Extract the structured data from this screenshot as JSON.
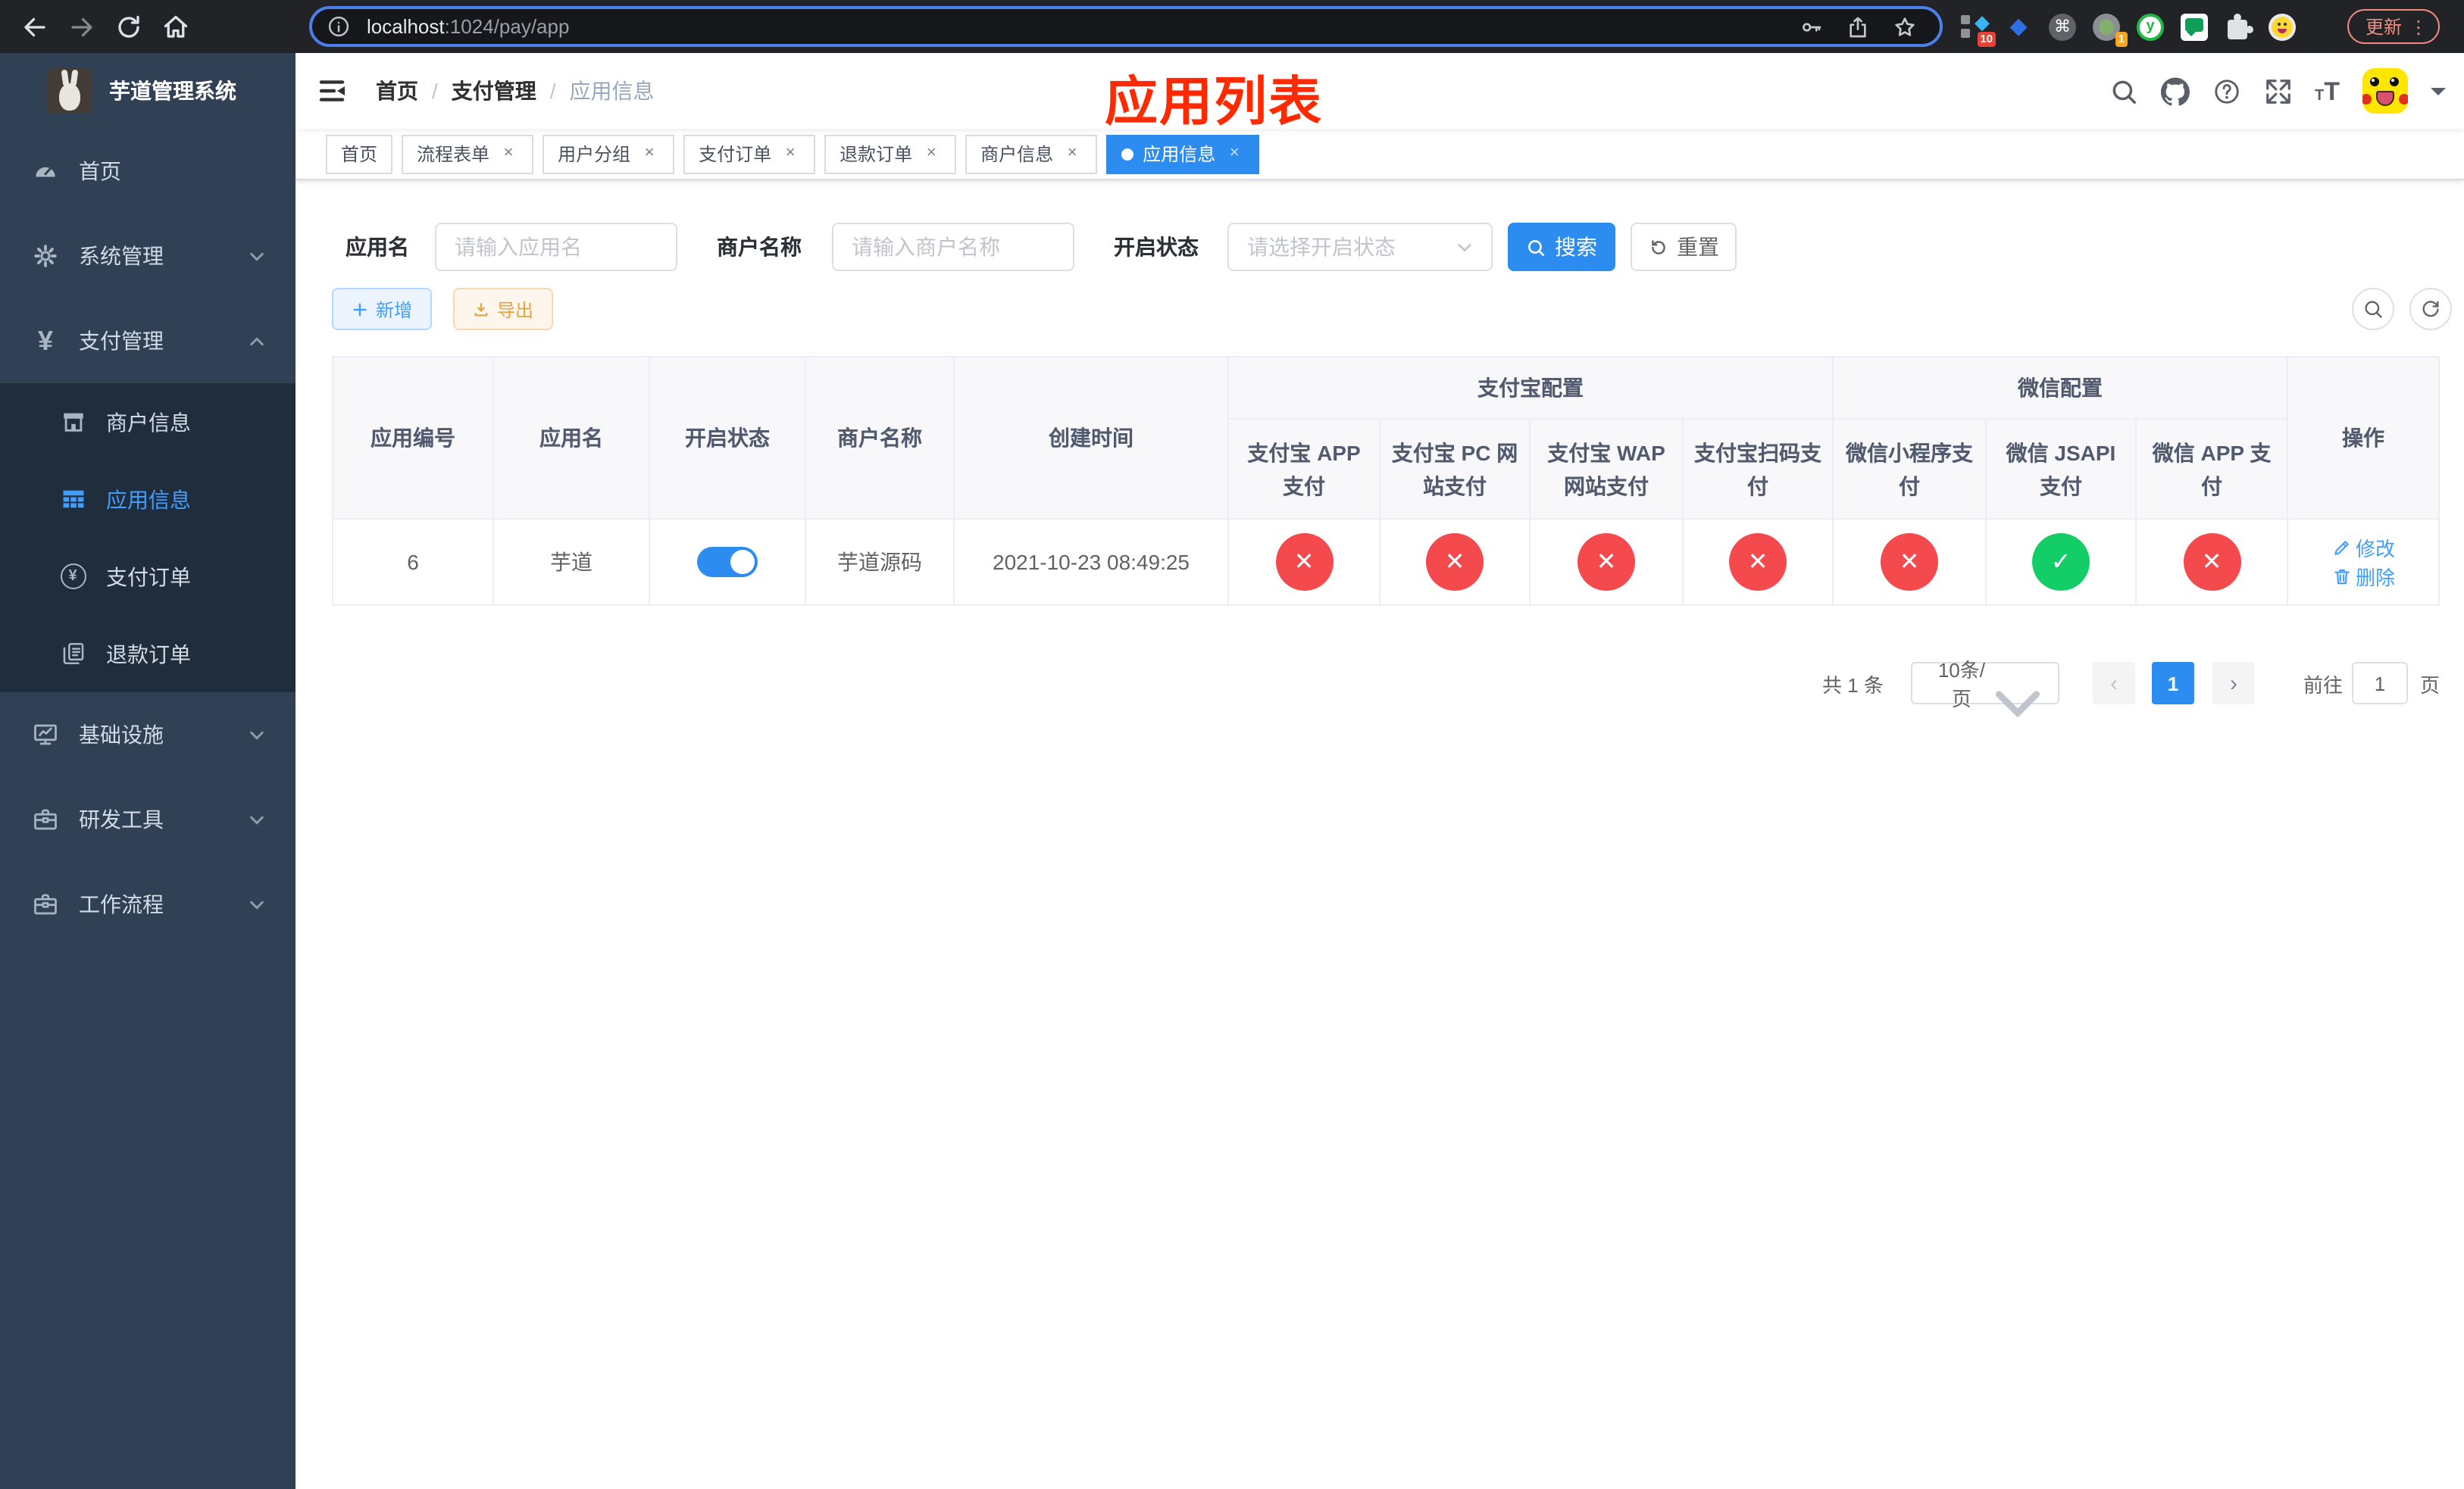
{
  "colors": {
    "accent_blue": "#409eff",
    "active_blue": "#2d8cf0",
    "danger_red": "#f4494d",
    "success_green": "#13ce66",
    "warning_orange": "#e6a23c",
    "overlay_title_red": "#ff2a00",
    "sidebar_bg": "#304156",
    "sidebar_submenu_bg": "#1f2d3d"
  },
  "icons": {
    "cmd_glyph": "⌘",
    "diamond_glyph": "◆",
    "kite_glyph": "◆",
    "dots_menu_glyph": "⋮",
    "prev_glyph": "‹",
    "next_glyph": "›",
    "check_glyph": "✓",
    "cross_glyph": "✕",
    "yen_glyph": "¥",
    "separator": "/",
    "y_letter": "y"
  },
  "browser": {
    "url_host": "localhost",
    "url_rest": ":1024/pay/app",
    "update_label": "更新",
    "ext_badge_vue": "10",
    "ext_badge_recorder": "1"
  },
  "sidebar": {
    "title": "芋道管理系统",
    "menu": [
      {
        "label": "首页"
      },
      {
        "label": "系统管理",
        "expanded": false
      },
      {
        "label": "支付管理",
        "expanded": true
      },
      {
        "label": "基础设施",
        "expanded": false
      },
      {
        "label": "研发工具",
        "expanded": false
      },
      {
        "label": "工作流程",
        "expanded": false
      }
    ],
    "submenu": [
      {
        "label": "商户信息",
        "active": false
      },
      {
        "label": "应用信息",
        "active": true
      },
      {
        "label": "支付订单",
        "active": false
      },
      {
        "label": "退款订单",
        "active": false
      }
    ]
  },
  "navbar": {
    "breadcrumb": [
      "首页",
      "支付管理",
      "应用信息"
    ],
    "overlay_title": "应用列表"
  },
  "tabs": [
    {
      "label": "首页",
      "closable": false,
      "active": false
    },
    {
      "label": "流程表单",
      "closable": true,
      "active": false
    },
    {
      "label": "用户分组",
      "closable": true,
      "active": false
    },
    {
      "label": "支付订单",
      "closable": true,
      "active": false
    },
    {
      "label": "退款订单",
      "closable": true,
      "active": false
    },
    {
      "label": "商户信息",
      "closable": true,
      "active": false
    },
    {
      "label": "应用信息",
      "closable": true,
      "active": true
    }
  ],
  "filters": {
    "app_name_label": "应用名",
    "app_name_placeholder": "请输入应用名",
    "merchant_label": "商户名称",
    "merchant_placeholder": "请输入商户名称",
    "status_label": "开启状态",
    "status_placeholder": "请选择开启状态",
    "search_label": "搜索",
    "reset_label": "重置"
  },
  "toolbar": {
    "add_label": "新增",
    "export_label": "导出"
  },
  "table": {
    "headers": {
      "app_id": "应用编号",
      "app_name": "应用名",
      "status": "开启状态",
      "merchant": "商户名称",
      "created": "创建时间",
      "alipay_group": "支付宝配置",
      "wechat_group": "微信配置",
      "alipay_app": "支付宝 APP 支付",
      "alipay_pc": "支付宝 PC 网站支付",
      "alipay_wap": "支付宝 WAP 网站支付",
      "alipay_qr": "支付宝扫码支付",
      "wx_mini": "微信小程序支付",
      "wx_jsapi": "微信 JSAPI 支付",
      "wx_app": "微信 APP 支付",
      "actions": "操作"
    },
    "rows": [
      {
        "app_id": "6",
        "app_name": "芋道",
        "status_on": true,
        "merchant": "芋道源码",
        "created": "2021-10-23 08:49:25",
        "alipay_app": false,
        "alipay_pc": false,
        "alipay_wap": false,
        "alipay_qr": false,
        "wx_mini": false,
        "wx_jsapi": true,
        "wx_app": false,
        "edit_label": "修改",
        "delete_label": "删除"
      }
    ]
  },
  "pagination": {
    "total_text": "共 1 条",
    "page_size": "10条/页",
    "current_page": "1",
    "goto_label": "前往",
    "goto_value": "1",
    "page_unit": "页"
  }
}
